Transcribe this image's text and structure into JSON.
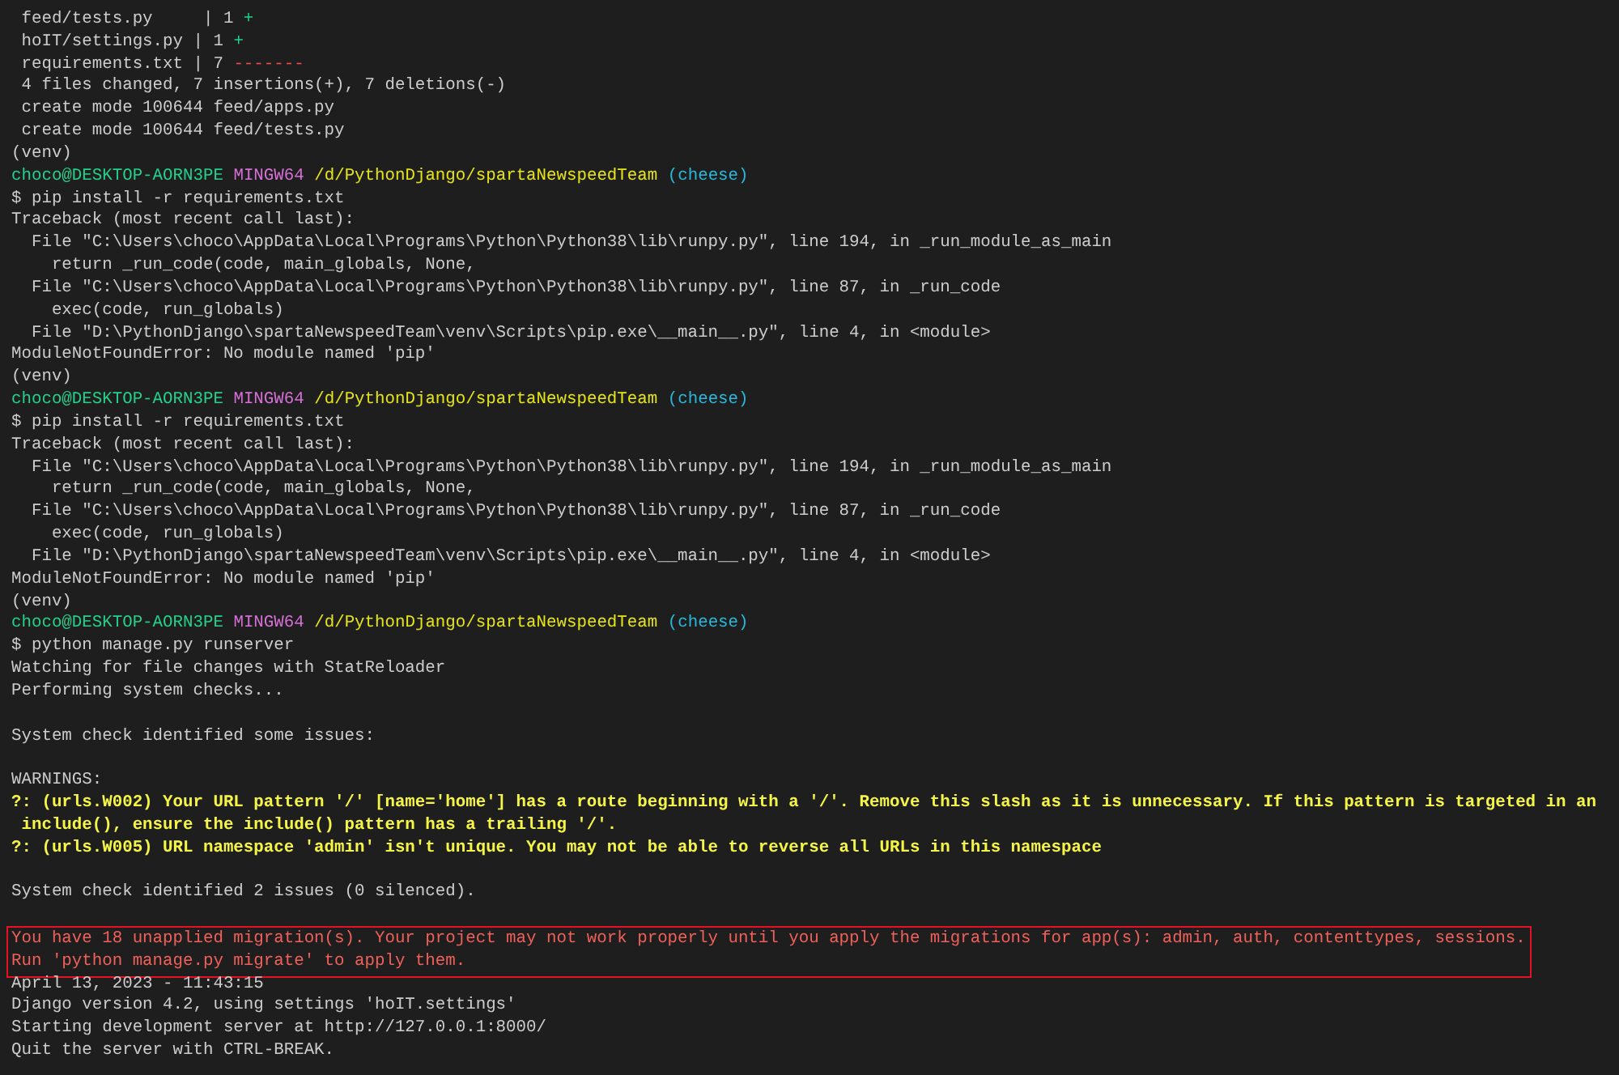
{
  "terminal": {
    "blocks": [
      {
        "kind": "plain",
        "lines": [
          {
            "kind": "stat",
            "segments": [
              {
                "kind": "text",
                "text": " feed/tests.py     | 1 "
              },
              {
                "kind": "add",
                "text": "+"
              }
            ]
          },
          {
            "kind": "stat",
            "segments": [
              {
                "kind": "text",
                "text": " hoIT/settings.py | 1 "
              },
              {
                "kind": "add",
                "text": "+"
              }
            ]
          },
          {
            "kind": "stat",
            "segments": [
              {
                "kind": "text",
                "text": " requirements.txt | 7 "
              },
              {
                "kind": "del",
                "text": "-------"
              }
            ]
          },
          {
            "kind": "output",
            "text": " 4 files changed, 7 insertions(+), 7 deletions(-)"
          },
          {
            "kind": "output",
            "text": " create mode 100644 feed/apps.py"
          },
          {
            "kind": "output",
            "text": " create mode 100644 feed/tests.py"
          },
          {
            "kind": "output",
            "text": "(venv)"
          },
          {
            "kind": "prompt",
            "segments": [
              {
                "kind": "user",
                "text": "choco@DESKTOP-AORN3PE"
              },
              {
                "kind": "host",
                "text": "MINGW64"
              },
              {
                "kind": "path",
                "text": "/d/PythonDjango/spartaNewspeedTeam"
              },
              {
                "kind": "branch",
                "text": "(cheese)"
              }
            ]
          },
          {
            "kind": "command",
            "text": "$ pip install -r requirements.txt"
          },
          {
            "kind": "output",
            "text": "Traceback (most recent call last):"
          },
          {
            "kind": "output",
            "text": "  File \"C:\\Users\\choco\\AppData\\Local\\Programs\\Python\\Python38\\lib\\runpy.py\", line 194, in _run_module_as_main"
          },
          {
            "kind": "output",
            "text": "    return _run_code(code, main_globals, None,"
          },
          {
            "kind": "output",
            "text": "  File \"C:\\Users\\choco\\AppData\\Local\\Programs\\Python\\Python38\\lib\\runpy.py\", line 87, in _run_code"
          },
          {
            "kind": "output",
            "text": "    exec(code, run_globals)"
          },
          {
            "kind": "output",
            "text": "  File \"D:\\PythonDjango\\spartaNewspeedTeam\\venv\\Scripts\\pip.exe\\__main__.py\", line 4, in <module>"
          },
          {
            "kind": "output",
            "text": "ModuleNotFoundError: No module named 'pip'"
          },
          {
            "kind": "output",
            "text": "(venv)"
          },
          {
            "kind": "prompt",
            "segments": [
              {
                "kind": "user",
                "text": "choco@DESKTOP-AORN3PE"
              },
              {
                "kind": "host",
                "text": "MINGW64"
              },
              {
                "kind": "path",
                "text": "/d/PythonDjango/spartaNewspeedTeam"
              },
              {
                "kind": "branch",
                "text": "(cheese)"
              }
            ]
          },
          {
            "kind": "command",
            "text": "$ pip install -r requirements.txt"
          },
          {
            "kind": "output",
            "text": "Traceback (most recent call last):"
          },
          {
            "kind": "output",
            "text": "  File \"C:\\Users\\choco\\AppData\\Local\\Programs\\Python\\Python38\\lib\\runpy.py\", line 194, in _run_module_as_main"
          },
          {
            "kind": "output",
            "text": "    return _run_code(code, main_globals, None,"
          },
          {
            "kind": "output",
            "text": "  File \"C:\\Users\\choco\\AppData\\Local\\Programs\\Python\\Python38\\lib\\runpy.py\", line 87, in _run_code"
          },
          {
            "kind": "output",
            "text": "    exec(code, run_globals)"
          },
          {
            "kind": "output",
            "text": "  File \"D:\\PythonDjango\\spartaNewspeedTeam\\venv\\Scripts\\pip.exe\\__main__.py\", line 4, in <module>"
          },
          {
            "kind": "output",
            "text": "ModuleNotFoundError: No module named 'pip'"
          },
          {
            "kind": "output",
            "text": "(venv)"
          },
          {
            "kind": "prompt",
            "segments": [
              {
                "kind": "user",
                "text": "choco@DESKTOP-AORN3PE"
              },
              {
                "kind": "host",
                "text": "MINGW64"
              },
              {
                "kind": "path",
                "text": "/d/PythonDjango/spartaNewspeedTeam"
              },
              {
                "kind": "branch",
                "text": "(cheese)"
              }
            ]
          },
          {
            "kind": "command",
            "text": "$ python manage.py runserver"
          },
          {
            "kind": "output",
            "text": "Watching for file changes with StatReloader"
          },
          {
            "kind": "output",
            "text": "Performing system checks..."
          },
          {
            "kind": "blank"
          },
          {
            "kind": "output",
            "text": "System check identified some issues:"
          },
          {
            "kind": "blank"
          },
          {
            "kind": "output",
            "text": "WARNINGS:"
          },
          {
            "kind": "warning",
            "text": "?: (urls.W002) Your URL pattern '/' [name='home'] has a route beginning with a '/'. Remove this slash as it is unnecessary. If this pattern is targeted in an"
          },
          {
            "kind": "warning",
            "text": " include(), ensure the include() pattern has a trailing '/'."
          },
          {
            "kind": "warning",
            "text": "?: (urls.W005) URL namespace 'admin' isn't unique. You may not be able to reverse all URLs in this namespace"
          },
          {
            "kind": "blank"
          },
          {
            "kind": "output",
            "text": "System check identified 2 issues (0 silenced)."
          },
          {
            "kind": "blank"
          }
        ]
      },
      {
        "kind": "boxed",
        "lines": [
          {
            "kind": "error",
            "text": "You have 18 unapplied migration(s). Your project may not work properly until you apply the migrations for app(s): admin, auth, contenttypes, sessions."
          },
          {
            "kind": "error",
            "text": "Run 'python manage.py migrate' to apply them."
          }
        ]
      },
      {
        "kind": "plain",
        "lines": [
          {
            "kind": "output",
            "text": "April 13, 2023 - 11:43:15"
          },
          {
            "kind": "output",
            "text": "Django version 4.2, using settings 'hoIT.settings'"
          },
          {
            "kind": "output",
            "text": "Starting development server at http://127.0.0.1:8000/"
          },
          {
            "kind": "output",
            "text": "Quit the server with CTRL-BREAK."
          }
        ]
      }
    ]
  }
}
